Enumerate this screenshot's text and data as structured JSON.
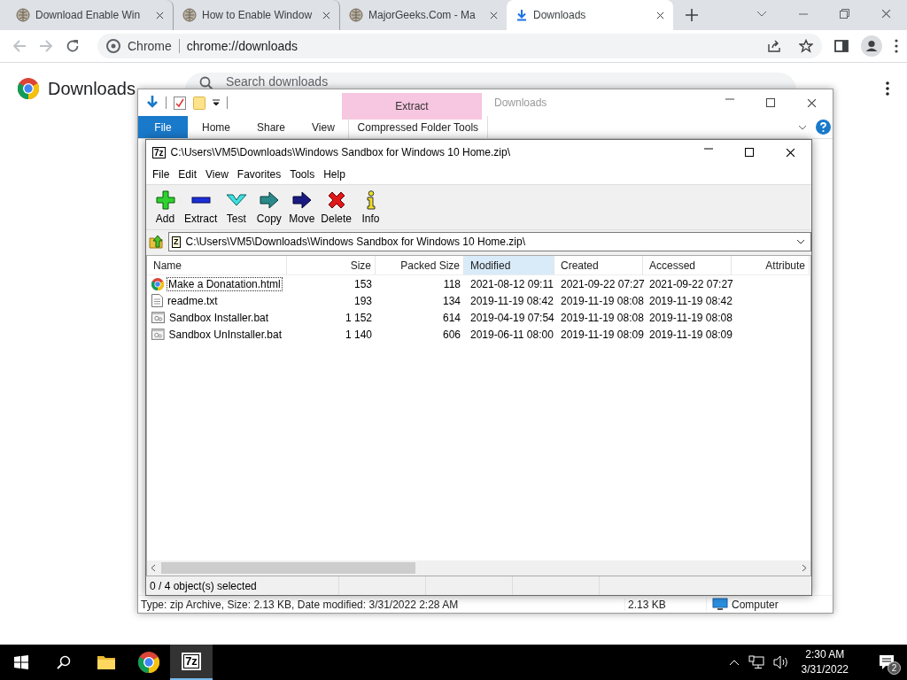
{
  "browser": {
    "tabs": [
      {
        "title": "Download Enable Win",
        "kind": "site",
        "selected": false
      },
      {
        "title": "How to Enable Window",
        "kind": "site",
        "selected": false
      },
      {
        "title": "MajorGeeks.Com - Ma",
        "kind": "site",
        "selected": false
      },
      {
        "title": "Downloads",
        "kind": "downloads",
        "selected": true
      }
    ],
    "address": {
      "site_label": "Chrome",
      "url": "chrome://downloads"
    },
    "page": {
      "heading": "Downloads",
      "search": {
        "placeholder": "Search downloads"
      }
    }
  },
  "explorer": {
    "context_tab": "Extract",
    "title": "Downloads",
    "ribbon_tabs": [
      {
        "label": "File",
        "kind": "file"
      },
      {
        "label": "Home",
        "kind": "tab"
      },
      {
        "label": "Share",
        "kind": "tab"
      },
      {
        "label": "View",
        "kind": "tab"
      },
      {
        "label": "Compressed Folder Tools",
        "kind": "context"
      }
    ],
    "status_bar": {
      "info": "Type: zip Archive, Size: 2.13 KB, Date modified: 3/31/2022 2:28 AM",
      "size": "2.13 KB",
      "location": "Computer"
    }
  },
  "archiver": {
    "app_icon": "7z",
    "title": "C:\\Users\\VM5\\Downloads\\Windows Sandbox for Windows 10 Home.zip\\",
    "menu": [
      "File",
      "Edit",
      "View",
      "Favorites",
      "Tools",
      "Help"
    ],
    "toolbar": [
      {
        "label": "Add",
        "kind": "add"
      },
      {
        "label": "Extract",
        "kind": "extract"
      },
      {
        "label": "Test",
        "kind": "test"
      },
      {
        "label": "Copy",
        "kind": "copy"
      },
      {
        "label": "Move",
        "kind": "move"
      },
      {
        "label": "Delete",
        "kind": "delete"
      },
      {
        "label": "Info",
        "kind": "info"
      }
    ],
    "path_icon": "Z",
    "path": "C:\\Users\\VM5\\Downloads\\Windows Sandbox for Windows 10 Home.zip\\",
    "columns": [
      {
        "label": "Name",
        "highlighted": false
      },
      {
        "label": "Size",
        "highlighted": false
      },
      {
        "label": "Packed Size",
        "highlighted": false
      },
      {
        "label": "Modified",
        "highlighted": true
      },
      {
        "label": "Created",
        "highlighted": false
      },
      {
        "label": "Accessed",
        "highlighted": false
      },
      {
        "label": "Attribute",
        "highlighted": false
      }
    ],
    "rows": [
      {
        "kind": "web",
        "focused": true,
        "cells": [
          "Make a Donatation.html",
          "153",
          "118",
          "2021-08-12 09:11",
          "2021-09-22 07:27",
          "2021-09-22 07:27"
        ]
      },
      {
        "kind": "text",
        "focused": false,
        "cells": [
          "readme.txt",
          "193",
          "134",
          "2019-11-19 08:42",
          "2019-11-19 08:08",
          "2019-11-19 08:42"
        ]
      },
      {
        "kind": "batch",
        "focused": false,
        "cells": [
          "Sandbox Installer.bat",
          "1 152",
          "614",
          "2019-04-19 07:54",
          "2019-11-19 08:08",
          "2019-11-19 08:08"
        ]
      },
      {
        "kind": "batch",
        "focused": false,
        "cells": [
          "Sandbox UnInstaller.bat",
          "1 140",
          "606",
          "2019-06-11 08:00",
          "2019-11-19 08:09",
          "2019-11-19 08:09"
        ]
      }
    ],
    "status": "0 / 4 object(s) selected"
  },
  "taskbar": {
    "apps": [
      {
        "kind": "explorer",
        "active": false
      },
      {
        "kind": "chrome",
        "active": false
      },
      {
        "kind": "archiver",
        "label": "7z",
        "active": true
      }
    ],
    "time": "2:30 AM",
    "date": "3/31/2022",
    "notifications": "2"
  }
}
